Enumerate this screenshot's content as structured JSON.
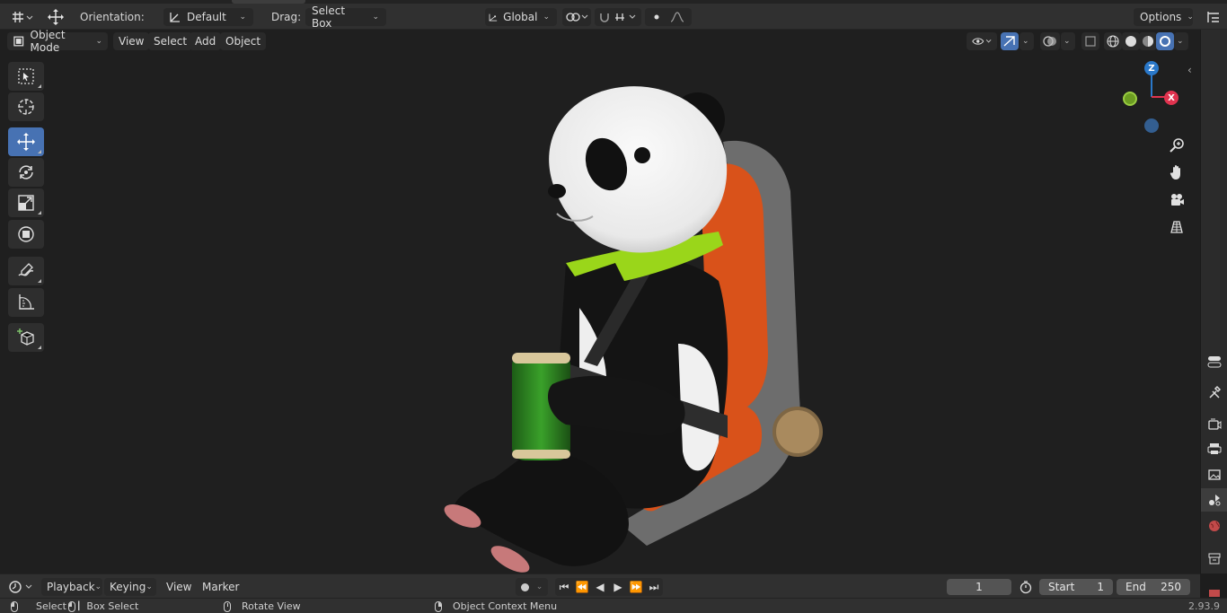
{
  "header": {
    "orientation_label": "Orientation:",
    "orientation_value": "Default",
    "drag_label": "Drag:",
    "drag_value": "Select Box",
    "transform_orientation": "Global",
    "options_label": "Options"
  },
  "viewport_header": {
    "mode": "Object Mode",
    "menus": [
      "View",
      "Select",
      "Add",
      "Object"
    ]
  },
  "tools": [
    {
      "name": "select-box-tool",
      "icon": "select-box-icon",
      "active": false
    },
    {
      "name": "cursor-tool",
      "icon": "cursor-icon",
      "active": false
    },
    {
      "name": "move-tool",
      "icon": "move-icon",
      "active": true
    },
    {
      "name": "rotate-tool",
      "icon": "rotate-icon",
      "active": false
    },
    {
      "name": "scale-tool",
      "icon": "scale-icon",
      "active": false
    },
    {
      "name": "transform-tool",
      "icon": "transform-icon",
      "active": false
    },
    {
      "name": "annotate-tool",
      "icon": "annotate-icon",
      "active": false
    },
    {
      "name": "measure-tool",
      "icon": "measure-icon",
      "active": false
    },
    {
      "name": "add-cube-tool",
      "icon": "add-cube-icon",
      "active": false
    }
  ],
  "gizmo": {
    "z": "Z",
    "x": "X"
  },
  "timeline": {
    "menus": [
      "Playback",
      "Keying",
      "View",
      "Marker"
    ],
    "current_frame": "1",
    "start_label": "Start",
    "start_value": "1",
    "end_label": "End",
    "end_value": "250"
  },
  "statusbar": {
    "select": "Select",
    "box_select": "Box Select",
    "rotate_view": "Rotate View",
    "context_menu": "Object Context Menu",
    "version": "2.93.9"
  },
  "colors": {
    "accent": "#4772b3",
    "axis_x": "#e0334f",
    "axis_y": "#6c9c22",
    "axis_z": "#2a78c9"
  }
}
